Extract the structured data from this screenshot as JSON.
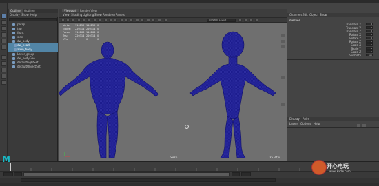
{
  "outliner": {
    "tabs": [
      "Outliner",
      "Outliner"
    ],
    "menu": [
      "Display",
      "Show",
      "Help"
    ],
    "rows": [
      {
        "label": "persp",
        "selected": false
      },
      {
        "label": "top",
        "selected": false
      },
      {
        "label": "front",
        "selected": false
      },
      {
        "label": "side",
        "selected": false
      },
      {
        "label": "dw_body",
        "selected": false
      },
      {
        "label": "dw_head",
        "selected": true
      },
      {
        "label": "alien_body",
        "selected": true
      },
      {
        "label": "Layer_group",
        "selected": false
      },
      {
        "label": "dw_bodyGeo",
        "selected": false
      },
      {
        "label": "defaultLightSet",
        "selected": false
      },
      {
        "label": "defaultObjectSet",
        "selected": false
      }
    ]
  },
  "viewport": {
    "tabs": [
      "Viewport",
      "Render View"
    ],
    "menu": [
      "View",
      "Shading",
      "Lighting",
      "Show",
      "Renderer",
      "Panels"
    ],
    "camera_field": "CUSTOM Layout",
    "hud": {
      "rows": [
        {
          "label": "Verts:",
          "v1": "110150",
          "v2": "110150",
          "v3": "0"
        },
        {
          "label": "Edges:",
          "v1": "220314",
          "v2": "220314",
          "v3": "0"
        },
        {
          "label": "Faces:",
          "v1": "110166",
          "v2": "110166",
          "v3": "0"
        },
        {
          "label": "Tris:",
          "v1": "220314",
          "v2": "220314",
          "v3": "0"
        },
        {
          "label": "UVs:",
          "v1": "0",
          "v2": "0",
          "v3": "0"
        }
      ]
    },
    "camera_label": "persp",
    "fps_label": "25.3 fps",
    "wire_color": "#1a1a8c",
    "bg_color": "#6f6f6f"
  },
  "channel_box": {
    "tabs": [
      "Channels",
      "Edit",
      "Object",
      "Show"
    ],
    "object_name": "meshes",
    "attributes": [
      {
        "label": "Translate X",
        "value": "0"
      },
      {
        "label": "Translate Y",
        "value": "0"
      },
      {
        "label": "Translate Z",
        "value": "0"
      },
      {
        "label": "Rotate X",
        "value": "0"
      },
      {
        "label": "Rotate Y",
        "value": "0"
      },
      {
        "label": "Rotate Z",
        "value": "0"
      },
      {
        "label": "Scale X",
        "value": "1"
      },
      {
        "label": "Scale Y",
        "value": "1"
      },
      {
        "label": "Scale Z",
        "value": "1"
      },
      {
        "label": "Visibility",
        "value": "on"
      }
    ],
    "layer_tabs": [
      "Display",
      "Anim"
    ],
    "layer_menu": [
      "Layers",
      "Options",
      "Help"
    ]
  },
  "watermark": {
    "brand": "开心电玩",
    "url": "www.kxdw.com"
  },
  "logo_letter": "M"
}
